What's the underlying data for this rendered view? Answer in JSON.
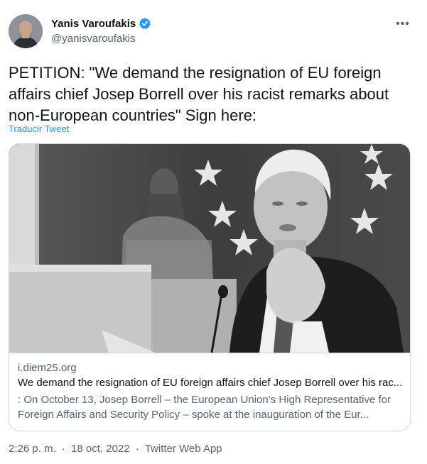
{
  "author": {
    "display_name": "Yanis Varoufakis",
    "handle": "@yanisvaroufakis",
    "verified_icon": "verified-badge-icon",
    "verified_color": "#1d9bf0"
  },
  "more_icon": "ellipsis-icon",
  "more_label": "•••",
  "tweet": {
    "text": "PETITION: \"We demand the resignation of EU foreign affairs chief Josep Borrell over his racist remarks about non-European countries\" Sign here:",
    "translate_label": "Traducir Tweet"
  },
  "card": {
    "domain": "i.diem25.org",
    "title": "We demand the resignation of EU foreign affairs chief Josep Borrell over his rac...",
    "description": ": On October 13, Josep Borrell – the European Union’s High Representative for Foreign Affairs and Security Policy – spoke at the inauguration of the Eur..."
  },
  "meta": {
    "time": "2:26 p. m.",
    "separator": "·",
    "date": "18 oct. 2022",
    "app": "Twitter Web App"
  }
}
